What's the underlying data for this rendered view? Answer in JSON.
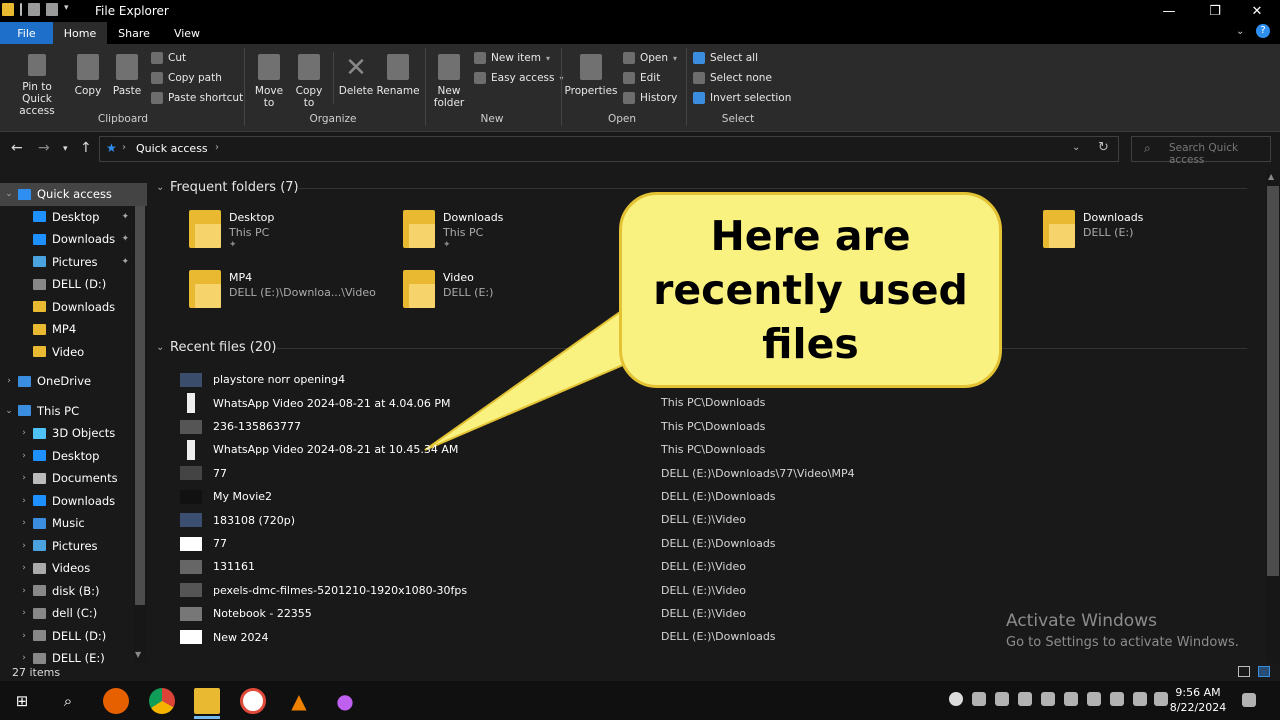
{
  "window": {
    "title": "File Explorer"
  },
  "ribbon_tabs": [
    "File",
    "Home",
    "Share",
    "View"
  ],
  "ribbon": {
    "clipboard": {
      "pin": "Pin to Quick\naccess",
      "copy": "Copy",
      "paste": "Paste",
      "cut": "Cut",
      "copy_path": "Copy path",
      "paste_shortcut": "Paste shortcut",
      "label": "Clipboard"
    },
    "organize": {
      "move_to": "Move\nto",
      "copy_to": "Copy\nto",
      "delete": "Delete",
      "rename": "Rename",
      "label": "Organize"
    },
    "new": {
      "new_folder": "New\nfolder",
      "new_item": "New item",
      "easy_access": "Easy access",
      "label": "New"
    },
    "open": {
      "properties": "Properties",
      "open": "Open",
      "edit": "Edit",
      "history": "History",
      "label": "Open"
    },
    "select": {
      "select_all": "Select all",
      "select_none": "Select none",
      "invert": "Invert selection",
      "label": "Select"
    }
  },
  "address": {
    "path": "Quick access",
    "search_placeholder": "Search Quick access"
  },
  "nav": [
    {
      "label": "Quick access",
      "icon": "star-icon",
      "color": "#2f8ff0",
      "level": 0,
      "chev": "v",
      "selected": true
    },
    {
      "label": "Desktop",
      "icon": "desktop-icon",
      "color": "#1e90ff",
      "level": 1,
      "pin": true
    },
    {
      "label": "Downloads",
      "icon": "download-icon",
      "color": "#1e90ff",
      "level": 1,
      "pin": true
    },
    {
      "label": "Pictures",
      "icon": "pictures-icon",
      "color": "#4aa3df",
      "level": 1,
      "pin": true
    },
    {
      "label": "DELL (D:)",
      "icon": "drive-icon",
      "color": "#888",
      "level": 1
    },
    {
      "label": "Downloads",
      "icon": "folder-icon",
      "color": "#e8b931",
      "level": 1
    },
    {
      "label": "MP4",
      "icon": "folder-icon",
      "color": "#e8b931",
      "level": 1
    },
    {
      "label": "Video",
      "icon": "folder-icon",
      "color": "#e8b931",
      "level": 1
    },
    {
      "label": "OneDrive",
      "icon": "cloud-icon",
      "color": "#3b8de0",
      "level": 0,
      "chev": ">"
    },
    {
      "label": "This PC",
      "icon": "pc-icon",
      "color": "#3b8de0",
      "level": 0,
      "chev": "v"
    },
    {
      "label": "3D Objects",
      "icon": "cube-icon",
      "color": "#4fc3f7",
      "level": 1,
      "chev": ">"
    },
    {
      "label": "Desktop",
      "icon": "desktop-icon",
      "color": "#1e90ff",
      "level": 1,
      "chev": ">"
    },
    {
      "label": "Documents",
      "icon": "documents-icon",
      "color": "#bbb",
      "level": 1,
      "chev": ">"
    },
    {
      "label": "Downloads",
      "icon": "download-icon",
      "color": "#1e90ff",
      "level": 1,
      "chev": ">"
    },
    {
      "label": "Music",
      "icon": "music-icon",
      "color": "#3b8de0",
      "level": 1,
      "chev": ">"
    },
    {
      "label": "Pictures",
      "icon": "pictures-icon",
      "color": "#4aa3df",
      "level": 1,
      "chev": ">"
    },
    {
      "label": "Videos",
      "icon": "videos-icon",
      "color": "#aaa",
      "level": 1,
      "chev": ">"
    },
    {
      "label": "disk (B:)",
      "icon": "drive-icon",
      "color": "#888",
      "level": 1,
      "chev": ">"
    },
    {
      "label": "dell (C:)",
      "icon": "drive-icon",
      "color": "#888",
      "level": 1,
      "chev": ">"
    },
    {
      "label": "DELL (D:)",
      "icon": "drive-icon",
      "color": "#888",
      "level": 1,
      "chev": ">"
    },
    {
      "label": "DELL (E:)",
      "icon": "drive-icon",
      "color": "#888",
      "level": 1,
      "chev": ">"
    }
  ],
  "frequent": {
    "header": "Frequent folders (7)",
    "folders": [
      {
        "name": "Desktop",
        "sub": "This PC",
        "pinned": true
      },
      {
        "name": "Downloads",
        "sub": "This PC",
        "pinned": true
      },
      {
        "name": "Downloads",
        "sub": "DELL (E:)"
      },
      {
        "name": "MP4",
        "sub": "DELL (E:)\\Downloa...\\Video"
      },
      {
        "name": "Video",
        "sub": "DELL (E:)"
      }
    ]
  },
  "recent": {
    "header": "Recent files (20)",
    "files": [
      {
        "name": "playstore norr opening4",
        "path": ""
      },
      {
        "name": "WhatsApp Video 2024-08-21 at 4.04.06 PM",
        "path": "This PC\\Downloads"
      },
      {
        "name": "236-135863777",
        "path": "This PC\\Downloads"
      },
      {
        "name": "WhatsApp Video 2024-08-21 at 10.45.34 AM",
        "path": "This PC\\Downloads"
      },
      {
        "name": "77",
        "path": "DELL (E:)\\Downloads\\77\\Video\\MP4"
      },
      {
        "name": "My Movie2",
        "path": "DELL (E:)\\Downloads"
      },
      {
        "name": "183108 (720p)",
        "path": "DELL (E:)\\Video"
      },
      {
        "name": "77",
        "path": "DELL (E:)\\Downloads"
      },
      {
        "name": "131161",
        "path": "DELL (E:)\\Video"
      },
      {
        "name": "pexels-dmc-filmes-5201210-1920x1080-30fps",
        "path": "DELL (E:)\\Video"
      },
      {
        "name": "Notebook - 22355",
        "path": "DELL (E:)\\Video"
      },
      {
        "name": "New 2024",
        "path": "DELL (E:)\\Downloads"
      }
    ]
  },
  "callout": {
    "text": "Here are recently used files"
  },
  "watermark": {
    "line1": "Activate Windows",
    "line2": "Go to Settings to activate Windows."
  },
  "status": {
    "items": "27 items"
  },
  "clock": {
    "time": "9:56 AM",
    "date": "8/22/2024"
  }
}
